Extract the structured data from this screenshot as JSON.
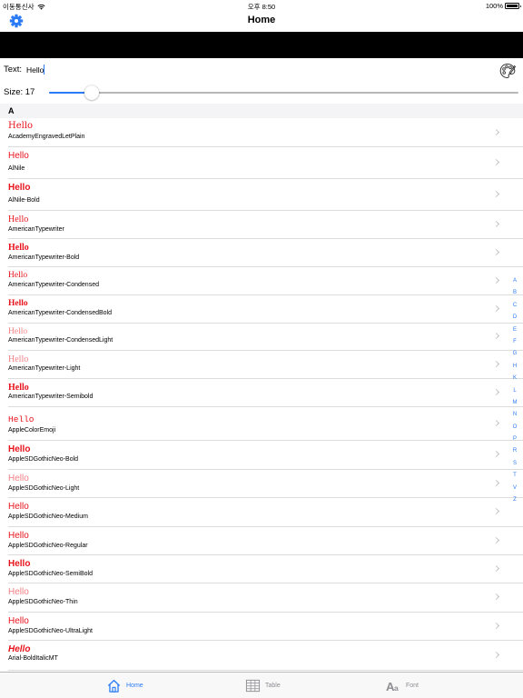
{
  "status_bar": {
    "carrier": "이동통신사",
    "time": "오후 8:50",
    "battery": "100%",
    "battery_level": 1.0
  },
  "nav": {
    "title": "Home",
    "settings_icon": "gear-icon"
  },
  "text_field": {
    "label": "Text:",
    "value": "Hello",
    "palette_icon": "palette-icon"
  },
  "size_control": {
    "label": "Size: 17",
    "value_fraction": 0.075
  },
  "section": {
    "title": "A"
  },
  "sample_color": "#e8131b",
  "accent_color": "#2a7bf5",
  "fonts": [
    {
      "sample": "Hello",
      "name": "AcademyEngravedLetPlain"
    },
    {
      "sample": "Hello",
      "name": "AlNile"
    },
    {
      "sample": "Hello",
      "name": "AlNile-Bold"
    },
    {
      "sample": "Hello",
      "name": "AmericanTypewriter"
    },
    {
      "sample": "Hello",
      "name": "AmericanTypewriter-Bold"
    },
    {
      "sample": "Hello",
      "name": "AmericanTypewriter-Condensed"
    },
    {
      "sample": "Hello",
      "name": "AmericanTypewriter-CondensedBold"
    },
    {
      "sample": "Hello",
      "name": "AmericanTypewriter-CondensedLight"
    },
    {
      "sample": "Hello",
      "name": "AmericanTypewriter-Light"
    },
    {
      "sample": "Hello",
      "name": "AmericanTypewriter-Semibold"
    },
    {
      "sample": "Hello",
      "name": "AppleColorEmoji"
    },
    {
      "sample": "Hello",
      "name": "AppleSDGothicNeo-Bold"
    },
    {
      "sample": "Hello",
      "name": "AppleSDGothicNeo-Light"
    },
    {
      "sample": "Hello",
      "name": "AppleSDGothicNeo-Medium"
    },
    {
      "sample": "Hello",
      "name": "AppleSDGothicNeo-Regular"
    },
    {
      "sample": "Hello",
      "name": "AppleSDGothicNeo-SemiBold"
    },
    {
      "sample": "Hello",
      "name": "AppleSDGothicNeo-Thin"
    },
    {
      "sample": "Hello",
      "name": "AppleSDGothicNeo-UltraLight"
    },
    {
      "sample": "Hello",
      "name": "Arial-BoldItalicMT"
    }
  ],
  "index_letters": [
    "A",
    "B",
    "C",
    "D",
    "E",
    "F",
    "G",
    "H",
    "K",
    "L",
    "M",
    "N",
    "O",
    "P",
    "R",
    "S",
    "T",
    "V",
    "Z"
  ],
  "tabs": [
    {
      "label": "Home",
      "icon": "home-icon",
      "active": true
    },
    {
      "label": "Table",
      "icon": "table-icon",
      "active": false
    },
    {
      "label": "Font",
      "icon": "font-icon",
      "active": false
    }
  ]
}
